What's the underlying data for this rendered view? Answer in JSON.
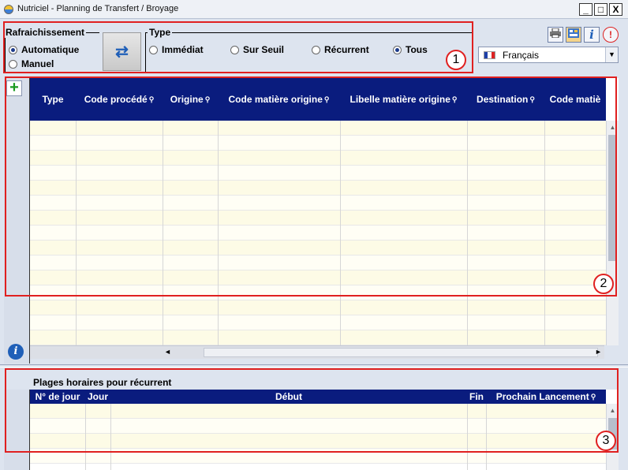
{
  "window": {
    "title": "Nutriciel - Planning de Transfert / Broyage",
    "minimize": "_",
    "maximize": "□",
    "close": "X"
  },
  "refresh": {
    "legend": "Rafraichissement",
    "options": [
      {
        "label": "Automatique",
        "selected": true
      },
      {
        "label": "Manuel",
        "selected": false
      }
    ]
  },
  "type_group": {
    "legend": "Type",
    "options": [
      {
        "label": "Immédiat",
        "selected": false
      },
      {
        "label": "Sur Seuil",
        "selected": false
      },
      {
        "label": "Récurrent",
        "selected": false
      },
      {
        "label": "Tous",
        "selected": true
      }
    ]
  },
  "toolbar": {
    "print_icon": "printer-icon",
    "settings_icon": "settings-icon",
    "info_label": "i",
    "alert_label": "!"
  },
  "language": {
    "value": "Français"
  },
  "callouts": [
    "1",
    "2",
    "3"
  ],
  "main_grid": {
    "columns": [
      "Type",
      "Code procédé",
      "Origine",
      "Code matière origine",
      "Libelle matière origine",
      "Destination",
      "Code matiè"
    ],
    "searchable": [
      false,
      true,
      true,
      true,
      true,
      true,
      false
    ],
    "row_count": 15
  },
  "bottom": {
    "title": "Plages horaires pour récurrent",
    "columns": [
      "N° de jour",
      "Jour",
      "Début",
      "Fin",
      "Prochain Lancement"
    ],
    "searchable": [
      false,
      false,
      false,
      false,
      true
    ],
    "row_count": 3
  },
  "colors": {
    "header_bg": "#0a1c7e",
    "callout_border": "#e02020",
    "row_odd": "#fdfbe6",
    "accent_blue": "#1f5fb8"
  }
}
